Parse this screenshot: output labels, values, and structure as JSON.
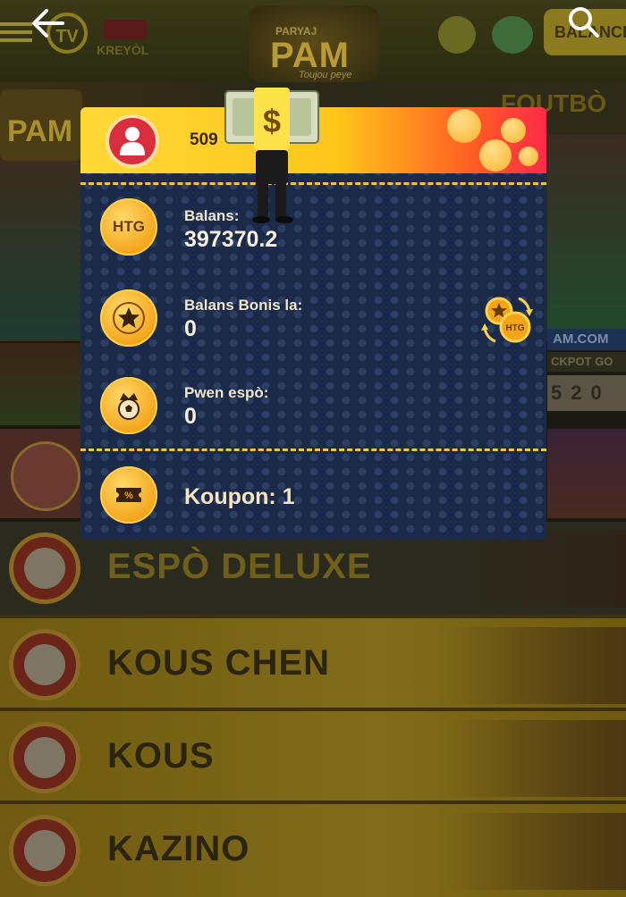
{
  "header": {
    "tv_label": "TV",
    "language": "KREYÒL",
    "logo_top": "PARYAJ",
    "logo_main": "PAM",
    "logo_tagline": "Toujou peye",
    "balance_button": "BALANCE"
  },
  "background": {
    "foutbol_text": "FOUTBÒ",
    "site_text": "AM.COM",
    "jackpot_text": "CKPOT GO",
    "jackpot_digits": "520",
    "menu_rows": [
      {
        "label": "ESPÒ DELUXE"
      },
      {
        "label": "KOUS CHEN"
      },
      {
        "label": "KOUS"
      },
      {
        "label": "KAZINO"
      }
    ]
  },
  "popup": {
    "phone": "509",
    "balance": {
      "label": "Balans:",
      "value": "397370.2",
      "icon_text": "HTG"
    },
    "bonus": {
      "label": "Balans Bonis la:",
      "value": "0"
    },
    "sport_points": {
      "label": "Pwen espò:",
      "value": "0"
    },
    "coupon": {
      "label": "Koupon: 1"
    },
    "convert_icon_text": "HTG"
  },
  "colors": {
    "popup_bg": "#1a2a48",
    "header_gradient_start": "#ffd838",
    "header_gradient_end": "#ff2a4a",
    "coin": "#f3a51a",
    "dash": "#f6c43a"
  }
}
